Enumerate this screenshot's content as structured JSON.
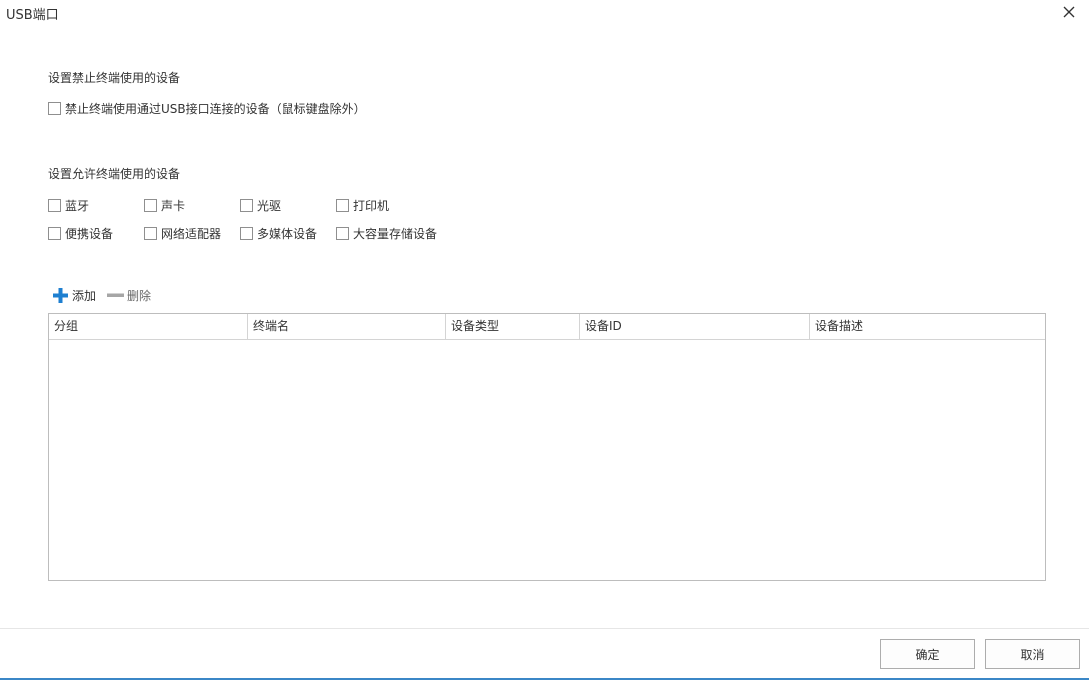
{
  "window": {
    "title": "USB端口",
    "close_icon": "close-icon"
  },
  "forbid_section": {
    "label": "设置禁止终端使用的设备",
    "checkbox": {
      "label": "禁止终端使用通过USB接口连接的设备（鼠标键盘除外）",
      "checked": false
    }
  },
  "allow_section": {
    "label": "设置允许终端使用的设备",
    "options": [
      {
        "label": "蓝牙",
        "checked": false
      },
      {
        "label": "声卡",
        "checked": false
      },
      {
        "label": "光驱",
        "checked": false
      },
      {
        "label": "打印机",
        "checked": false
      },
      {
        "label": "便携设备",
        "checked": false
      },
      {
        "label": "网络适配器",
        "checked": false
      },
      {
        "label": "多媒体设备",
        "checked": false
      },
      {
        "label": "大容量存储设备",
        "checked": false
      }
    ]
  },
  "toolbar": {
    "add_label": "添加",
    "add_icon": "plus-icon",
    "add_color": "#1e7fd0",
    "delete_label": "删除",
    "delete_icon": "minus-icon",
    "delete_color": "#a6a6a6"
  },
  "table": {
    "columns": [
      "分组",
      "终端名",
      "设备类型",
      "设备ID",
      "设备描述"
    ],
    "rows": []
  },
  "footer": {
    "ok_label": "确定",
    "cancel_label": "取消"
  },
  "colors": {
    "accent": "#3b87c7"
  }
}
